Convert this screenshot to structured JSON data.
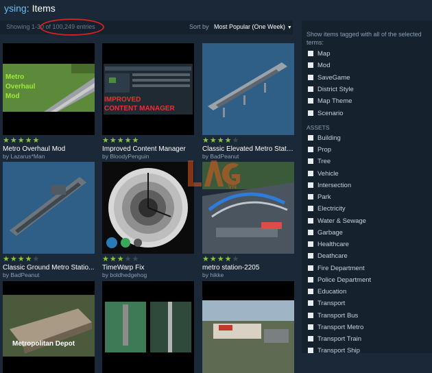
{
  "header": {
    "crumb_link": "Browsing",
    "crumb_visible_part": "ysing",
    "crumb_page": "Items"
  },
  "status": {
    "showing": "Showing 1-30 of 100,249 entries",
    "sort_label": "Sort by",
    "sort_value": "Most Popular (One Week)"
  },
  "items": [
    {
      "title": "Metro Overhaul Mod",
      "author": "by Lazarus*Man",
      "stars": 5,
      "thumb_text": [
        "Metro",
        "Overhaul",
        "Mod"
      ]
    },
    {
      "title": "Improved Content Manager",
      "author": "by BloodyPenguin",
      "stars": 5,
      "thumb_text": [
        "IMPROVED",
        "CONTENT MANAGER"
      ]
    },
    {
      "title": "Classic Elevated Metro Statio...",
      "author": "by BadPeanut",
      "stars": 4
    },
    {
      "title": "Classic Ground Metro Statio...",
      "author": "by BadPeanut",
      "stars": 4
    },
    {
      "title": "TimeWarp Fix",
      "author": "by boldhedgehog",
      "stars": 3
    },
    {
      "title": "metro station-2205",
      "author": "by hikke",
      "stars": 4
    },
    {
      "title": "",
      "author": "",
      "stars": 0,
      "thumb_text": [
        "Metropolitan Depot"
      ]
    },
    {
      "title": "",
      "author": "",
      "stars": 0
    },
    {
      "title": "",
      "author": "",
      "stars": 0
    }
  ],
  "watermark": {
    "text": "LAG.VN"
  },
  "sidebar": {
    "intro": "Show items tagged with all of the selected terms:",
    "tags": [
      "Map",
      "Mod",
      "SaveGame",
      "District Style",
      "Map Theme",
      "Scenario"
    ],
    "assets_heading": "ASSETS",
    "assets": [
      "Building",
      "Prop",
      "Tree",
      "Vehicle",
      "Intersection",
      "Park",
      "Electricity",
      "Water & Sewage",
      "Garbage",
      "Healthcare",
      "Deathcare",
      "Fire Department",
      "Police Department",
      "Education",
      "Transport",
      "Transport Bus",
      "Transport Metro",
      "Transport Train",
      "Transport Ship"
    ]
  },
  "colors": {
    "background": "#1b2838",
    "panel": "#16212e",
    "star_on": "#8bc53f",
    "link": "#66c0f4",
    "highlight_circle": "#d42020"
  }
}
